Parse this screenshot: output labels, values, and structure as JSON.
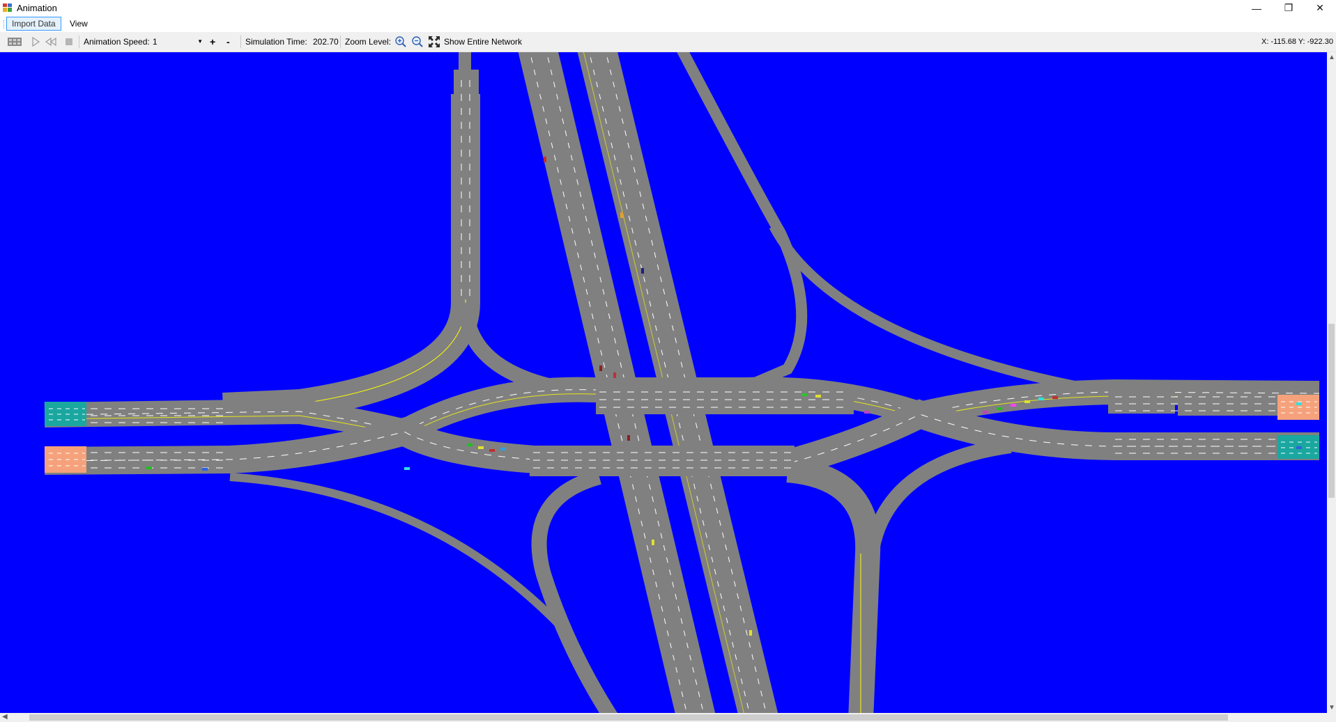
{
  "window": {
    "title": "Animation",
    "controls": {
      "minimize": "—",
      "restore": "❐",
      "close": "✕"
    }
  },
  "menu": {
    "items": [
      {
        "label": "Import Data"
      },
      {
        "label": "View"
      }
    ]
  },
  "toolbar": {
    "speed_label": "Animation Speed:",
    "speed_value": "1",
    "plus_label": "+",
    "minus_label": "-",
    "sim_time_label": "Simulation Time:",
    "sim_time_value": "202.70",
    "zoom_label": "Zoom Level:",
    "show_network_label": "Show Entire Network",
    "coords": "X: -115.68 Y: -922.30"
  },
  "canvas": {
    "background": "#0000ff",
    "road_color": "#808080",
    "lane_marking_color": "#ffffff",
    "centerline_color": "#ffff00",
    "zone_colors": {
      "teal": "#1aa7a0",
      "salmon": "#f5a27c"
    }
  },
  "icons": [
    "play-icon",
    "rewind-icon",
    "stop-icon",
    "zoom-in-icon",
    "zoom-out-icon",
    "fit-network-icon"
  ]
}
